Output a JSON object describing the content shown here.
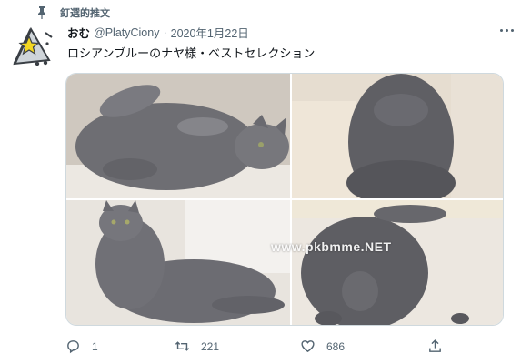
{
  "pinned": {
    "label": "釘選的推文",
    "icon": "pin-icon"
  },
  "author": {
    "name": "おむ",
    "handle": "@PlatyCiony",
    "date": "2020年1月22日",
    "separator": "·",
    "avatar_icon": "star-triangle-avatar"
  },
  "tweet": {
    "text": "ロシアンブルーのナヤ様・ベストセレクション"
  },
  "media": {
    "photos": [
      {
        "description": "gray cat lying on back"
      },
      {
        "description": "gray cat sitting close-up"
      },
      {
        "description": "gray cat sitting on bed"
      },
      {
        "description": "gray cat top view"
      }
    ],
    "watermark": "www.pkbmme.NET"
  },
  "actions": {
    "reply": {
      "icon": "reply-icon",
      "count": "1"
    },
    "retweet": {
      "icon": "retweet-icon",
      "count": "221"
    },
    "like": {
      "icon": "heart-icon",
      "count": "686"
    },
    "share": {
      "icon": "share-icon",
      "count": ""
    }
  },
  "colors": {
    "text": "#0f1419",
    "secondary": "#536471",
    "border": "#cfd9de",
    "cat": "#6d6d72"
  }
}
